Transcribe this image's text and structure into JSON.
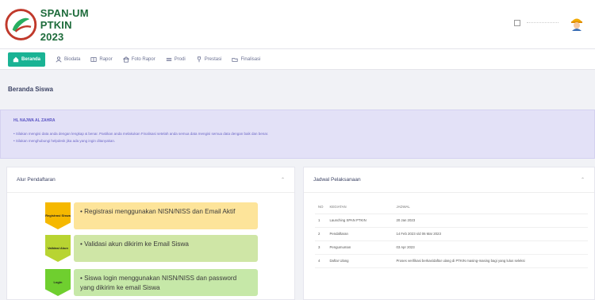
{
  "header": {
    "logo_line1": "SPAN-UM",
    "logo_line2": "PTKIN 2023"
  },
  "nav": [
    {
      "label": "Beranda",
      "icon": "home-icon",
      "active": true
    },
    {
      "label": "Biodata",
      "icon": "person-icon",
      "active": false
    },
    {
      "label": "Rapor",
      "icon": "book-icon",
      "active": false
    },
    {
      "label": "Foto Rapor",
      "icon": "building-icon",
      "active": false
    },
    {
      "label": "Prodi",
      "icon": "list-icon",
      "active": false
    },
    {
      "label": "Prestasi",
      "icon": "trophy-icon",
      "active": false
    },
    {
      "label": "Finalisasi",
      "icon": "folder-icon",
      "active": false
    }
  ],
  "page_title": "Beranda Siswa",
  "info": {
    "name": "HL NAJWA AL ZAHRA",
    "lines": [
      "• Silakan mengisi data anda dengan lengkap & benar. Pastikan anda melakukan Finalisasi setelah anda semua data mengisi semua data dengan baik dan benar.",
      "• Silakan menghubungi helpdesk jika ada yang ingin ditanyakan."
    ]
  },
  "alur": {
    "title": "Alur Pendaftaran",
    "steps": [
      {
        "tag": "Registrasi Siswa",
        "text": "• Registrasi menggunakan NISN/NISS dan Email Aktif",
        "tag_color": "#f5b800",
        "box_color": "#fde49a"
      },
      {
        "tag": "Validasi Akun",
        "text": "• Validasi akun dikirim ke Email Siswa",
        "tag_color": "#b8d432",
        "box_color": "#cfe6a6"
      },
      {
        "tag": "Login",
        "text": "• Siswa login menggunakan NISN/NISS dan password yang dikirim ke email Siswa",
        "tag_color": "#6fcf2f",
        "box_color": "#c6e8a8"
      }
    ]
  },
  "jadwal": {
    "title": "Jadwal Pelaksanaan",
    "columns": [
      "NO",
      "KEGIATAN",
      "JADWAL"
    ],
    "rows": [
      {
        "no": "1",
        "kegiatan": "Launching SPAN PTKIN",
        "jadwal": "20 Jan 2023"
      },
      {
        "no": "2",
        "kegiatan": "Pendaftaran",
        "jadwal": "14 Feb 2023 s/d 06 Mar 2023"
      },
      {
        "no": "3",
        "kegiatan": "Pengumuman",
        "jadwal": "03 Apr 2023"
      },
      {
        "no": "4",
        "kegiatan": "Daftar Ulang",
        "jadwal": "Proses verifikasi berkas/daftar ulang di PTKIN masing-masing bagi yang lulus seleksi"
      }
    ]
  }
}
